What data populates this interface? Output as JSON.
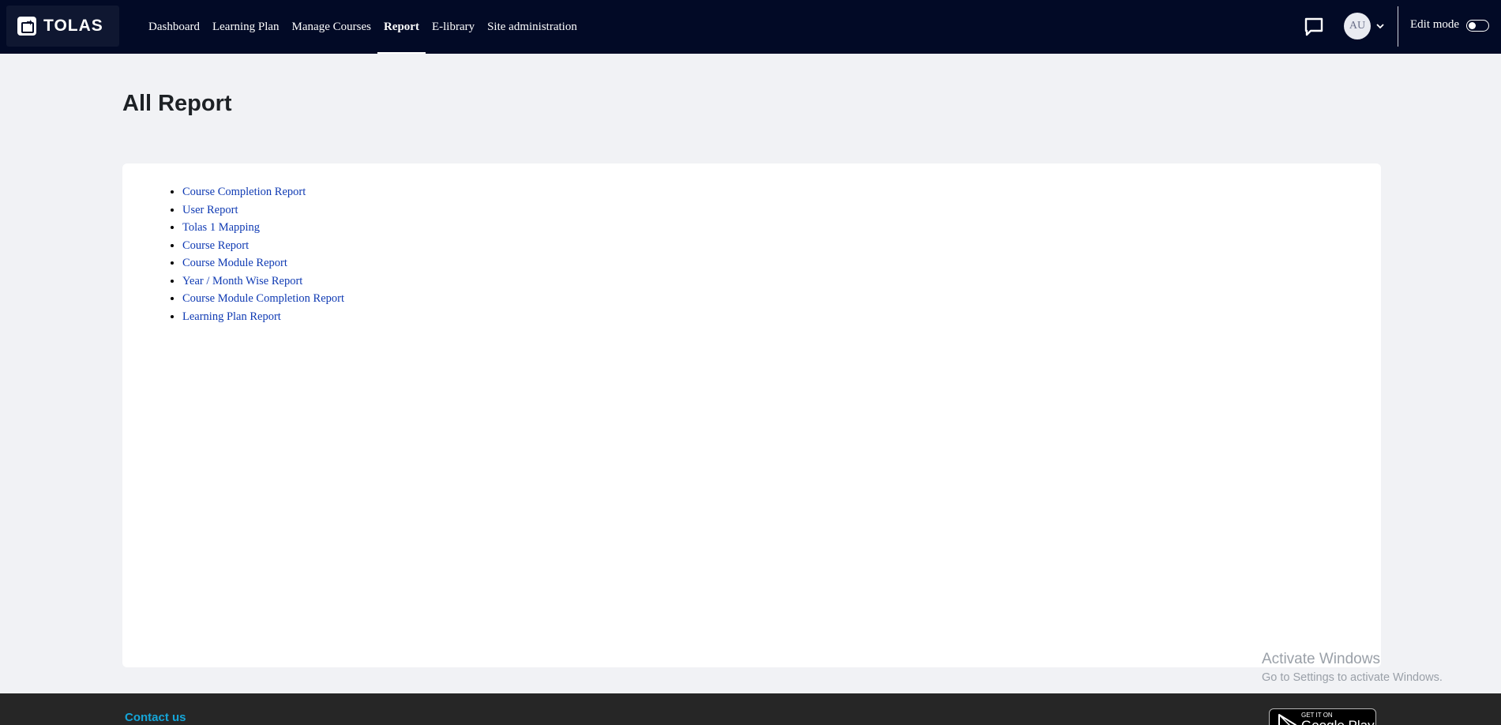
{
  "brand": {
    "name": "TOLAS"
  },
  "nav": {
    "links": [
      {
        "label": "Dashboard",
        "active": false
      },
      {
        "label": "Learning Plan",
        "active": false
      },
      {
        "label": "Manage Courses",
        "active": false
      },
      {
        "label": "Report",
        "active": true
      },
      {
        "label": "E-library",
        "active": false
      },
      {
        "label": "Site administration",
        "active": false
      }
    ],
    "avatar_initials": "AU",
    "edit_mode_label": "Edit mode",
    "edit_mode_on": false
  },
  "page": {
    "title": "All Report",
    "reports": [
      "Course Completion Report",
      "User Report",
      "Tolas 1 Mapping",
      "Course Report",
      "Course Module Report",
      "Year / Month Wise Report",
      "Course Module Completion Report",
      "Learning Plan Report"
    ]
  },
  "watermark": {
    "title": "Activate Windows",
    "subtitle": "Go to Settings to activate Windows."
  },
  "footer": {
    "contact_label": "Contact us",
    "store_badge_small": "GET IT ON",
    "store_badge_big": "Google Play"
  },
  "colors": {
    "nav_bg": "#020a26",
    "link": "#0f3ab3",
    "contact": "#15a5d8",
    "footer_bg": "#262626"
  }
}
